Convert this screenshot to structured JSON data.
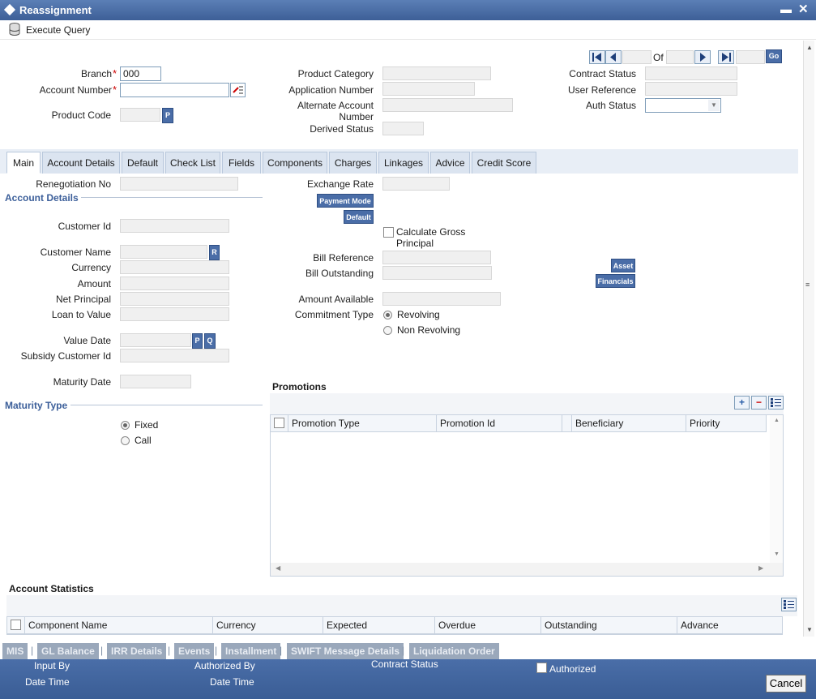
{
  "window": {
    "title": "Reassignment"
  },
  "toolbar": {
    "execute_query": "Execute Query"
  },
  "header": {
    "branch_label": "Branch",
    "branch_value": "000",
    "account_number_label": "Account Number",
    "product_code_label": "Product Code",
    "product_category_label": "Product Category",
    "application_number_label": "Application Number",
    "alternate_account_label_1": "Alternate Account",
    "alternate_account_label_2": "Number",
    "derived_status_label": "Derived Status",
    "of_label": "Of",
    "go_label": "Go",
    "contract_status_label": "Contract Status",
    "user_reference_label": "User Reference",
    "auth_status_label": "Auth Status",
    "p_label": "P"
  },
  "tabs": [
    "Main",
    "Account Details",
    "Default",
    "Check List",
    "Fields",
    "Components",
    "Charges",
    "Linkages",
    "Advice",
    "Credit Score"
  ],
  "main": {
    "renegotiation_no": "Renegotiation No",
    "account_details": "Account Details",
    "customer_id": "Customer Id",
    "customer_name": "Customer Name",
    "r_label": "R",
    "currency": "Currency",
    "amount": "Amount",
    "net_principal": "Net Principal",
    "loan_to_value": "Loan to Value",
    "value_date": "Value Date",
    "p_label": "P",
    "q_label": "Q",
    "subsidy_customer_id": "Subsidy Customer Id",
    "maturity_date": "Maturity Date",
    "maturity_type": "Maturity Type",
    "fixed": "Fixed",
    "call": "Call",
    "exchange_rate": "Exchange Rate",
    "payment_mode": "Payment Mode",
    "default_btn": "Default",
    "calc_gross_1": "Calculate Gross",
    "calc_gross_2": "Principal",
    "bill_reference": "Bill Reference",
    "bill_outstanding": "Bill Outstanding",
    "asset": "Asset",
    "financials": "Financials",
    "amount_available": "Amount Available",
    "commitment_type": "Commitment Type",
    "revolving": "Revolving",
    "non_revolving": "Non Revolving",
    "promotions": "Promotions",
    "promo_columns": [
      "Promotion Type",
      "Promotion Id",
      "Beneficiary",
      "Priority"
    ],
    "account_statistics": "Account Statistics",
    "stat_columns": [
      "Component Name",
      "Currency",
      "Expected",
      "Overdue",
      "Outstanding",
      "Advance"
    ]
  },
  "bottom_links": [
    "MIS",
    "GL Balance",
    "IRR Details",
    "Events",
    "Installment",
    "SWIFT Message Details",
    "Liquidation Order"
  ],
  "footer": {
    "input_by": "Input By",
    "date_time": "Date Time",
    "authorized_by": "Authorized By",
    "date_time_2": "Date Time",
    "contract_status": "Contract Status",
    "authorized": "Authorized",
    "cancel": "Cancel"
  },
  "colors": {
    "titlebar": "#4a6ea8",
    "accent": "#3c5f9a",
    "button": "#4a6da7"
  }
}
